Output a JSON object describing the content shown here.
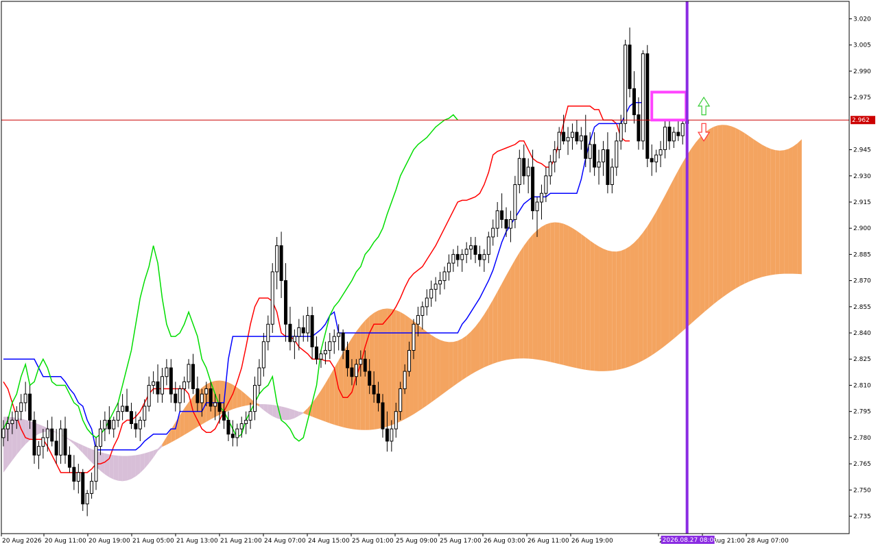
{
  "chart_data": {
    "type": "candlestick",
    "y_range": [
      2.725,
      3.03
    ],
    "y_ticks": [
      "3.020",
      "3.005",
      "2.990",
      "2.975",
      "2.962",
      "2.945",
      "2.930",
      "2.915",
      "2.900",
      "2.885",
      "2.870",
      "2.855",
      "2.840",
      "2.825",
      "2.810",
      "2.795",
      "2.780",
      "2.765",
      "2.750",
      "2.735"
    ],
    "x_ticks": [
      "20 Aug 2026",
      "20 Aug 11:00",
      "20 Aug 19:00",
      "21 Aug 05:00",
      "21 Aug 13:00",
      "21 Aug 21:00",
      "24 Aug 07:00",
      "24 Aug 15:00",
      "25 Aug 01:00",
      "25 Aug 09:00",
      "25 Aug 17:00",
      "26 Aug 03:00",
      "26 Aug 11:00",
      "26 Aug 19:00",
      "27 Aug 13:00",
      "27 Aug 21:00",
      "28 Aug 07:00"
    ],
    "current_price": {
      "value": 2.962,
      "label": "2.962"
    },
    "cursor": {
      "bar_index": 155,
      "label": "2026.08.27 08:00"
    },
    "candles": [
      [
        2.78,
        2.79,
        2.775,
        2.785
      ],
      [
        2.785,
        2.792,
        2.778,
        2.788
      ],
      [
        2.788,
        2.795,
        2.782,
        2.79
      ],
      [
        2.79,
        2.798,
        2.785,
        2.795
      ],
      [
        2.795,
        2.805,
        2.79,
        2.8
      ],
      [
        2.8,
        2.812,
        2.795,
        2.805
      ],
      [
        2.805,
        2.81,
        2.785,
        2.79
      ],
      [
        2.79,
        2.795,
        2.765,
        2.77
      ],
      [
        2.77,
        2.778,
        2.762,
        2.775
      ],
      [
        2.775,
        2.785,
        2.768,
        2.78
      ],
      [
        2.78,
        2.79,
        2.772,
        2.785
      ],
      [
        2.785,
        2.792,
        2.775,
        2.778
      ],
      [
        2.778,
        2.785,
        2.765,
        2.77
      ],
      [
        2.77,
        2.79,
        2.765,
        2.785
      ],
      [
        2.785,
        2.792,
        2.765,
        2.77
      ],
      [
        2.77,
        2.775,
        2.76,
        2.763
      ],
      [
        2.763,
        2.77,
        2.75,
        2.755
      ],
      [
        2.755,
        2.765,
        2.748,
        2.76
      ],
      [
        2.76,
        2.762,
        2.738,
        2.742
      ],
      [
        2.742,
        2.75,
        2.735,
        2.748
      ],
      [
        2.748,
        2.76,
        2.745,
        2.755
      ],
      [
        2.755,
        2.78,
        2.75,
        2.775
      ],
      [
        2.775,
        2.79,
        2.77,
        2.785
      ],
      [
        2.785,
        2.795,
        2.778,
        2.79
      ],
      [
        2.79,
        2.798,
        2.782,
        2.785
      ],
      [
        2.785,
        2.792,
        2.78,
        2.79
      ],
      [
        2.79,
        2.8,
        2.786,
        2.795
      ],
      [
        2.795,
        2.805,
        2.79,
        2.798
      ],
      [
        2.798,
        2.808,
        2.795,
        2.795
      ],
      [
        2.795,
        2.8,
        2.785,
        2.788
      ],
      [
        2.788,
        2.795,
        2.78,
        2.785
      ],
      [
        2.785,
        2.792,
        2.778,
        2.79
      ],
      [
        2.79,
        2.802,
        2.786,
        2.798
      ],
      [
        2.798,
        2.815,
        2.795,
        2.81
      ],
      [
        2.81,
        2.818,
        2.805,
        2.812
      ],
      [
        2.812,
        2.822,
        2.8,
        2.805
      ],
      [
        2.805,
        2.82,
        2.8,
        2.815
      ],
      [
        2.815,
        2.825,
        2.81,
        2.82
      ],
      [
        2.82,
        2.825,
        2.8,
        2.805
      ],
      [
        2.805,
        2.812,
        2.795,
        2.8
      ],
      [
        2.8,
        2.81,
        2.795,
        2.808
      ],
      [
        2.808,
        2.815,
        2.8,
        2.812
      ],
      [
        2.812,
        2.825,
        2.808,
        2.822
      ],
      [
        2.822,
        2.828,
        2.805,
        2.808
      ],
      [
        2.808,
        2.815,
        2.795,
        2.8
      ],
      [
        2.8,
        2.808,
        2.792,
        2.805
      ],
      [
        2.805,
        2.812,
        2.798,
        2.808
      ],
      [
        2.808,
        2.812,
        2.795,
        2.798
      ],
      [
        2.798,
        2.805,
        2.79,
        2.8
      ],
      [
        2.8,
        2.805,
        2.788,
        2.795
      ],
      [
        2.795,
        2.8,
        2.785,
        2.79
      ],
      [
        2.79,
        2.795,
        2.778,
        2.782
      ],
      [
        2.782,
        2.79,
        2.775,
        2.78
      ],
      [
        2.78,
        2.788,
        2.775,
        2.785
      ],
      [
        2.785,
        2.792,
        2.78,
        2.788
      ],
      [
        2.788,
        2.795,
        2.782,
        2.79
      ],
      [
        2.79,
        2.8,
        2.785,
        2.795
      ],
      [
        2.795,
        2.815,
        2.79,
        2.81
      ],
      [
        2.81,
        2.825,
        2.805,
        2.82
      ],
      [
        2.82,
        2.84,
        2.815,
        2.835
      ],
      [
        2.835,
        2.85,
        2.83,
        2.845
      ],
      [
        2.845,
        2.88,
        2.84,
        2.875
      ],
      [
        2.875,
        2.895,
        2.865,
        2.89
      ],
      [
        2.89,
        2.898,
        2.86,
        2.87
      ],
      [
        2.87,
        2.88,
        2.835,
        2.845
      ],
      [
        2.845,
        2.855,
        2.83,
        2.835
      ],
      [
        2.835,
        2.842,
        2.825,
        2.838
      ],
      [
        2.838,
        2.848,
        2.83,
        2.843
      ],
      [
        2.843,
        2.85,
        2.835,
        2.84
      ],
      [
        2.84,
        2.855,
        2.835,
        2.85
      ],
      [
        2.85,
        2.855,
        2.825,
        2.832
      ],
      [
        2.832,
        2.838,
        2.822,
        2.825
      ],
      [
        2.825,
        2.83,
        2.82,
        2.828
      ],
      [
        2.828,
        2.835,
        2.822,
        2.83
      ],
      [
        2.83,
        2.84,
        2.825,
        2.835
      ],
      [
        2.835,
        2.842,
        2.828,
        2.838
      ],
      [
        2.838,
        2.845,
        2.83,
        2.84
      ],
      [
        2.84,
        2.842,
        2.825,
        2.83
      ],
      [
        2.83,
        2.835,
        2.815,
        2.82
      ],
      [
        2.82,
        2.825,
        2.81,
        2.815
      ],
      [
        2.815,
        2.825,
        2.81,
        2.822
      ],
      [
        2.822,
        2.83,
        2.815,
        2.825
      ],
      [
        2.825,
        2.83,
        2.815,
        2.818
      ],
      [
        2.818,
        2.825,
        2.805,
        2.81
      ],
      [
        2.81,
        2.818,
        2.8,
        2.805
      ],
      [
        2.805,
        2.812,
        2.795,
        2.8
      ],
      [
        2.8,
        2.805,
        2.78,
        2.785
      ],
      [
        2.785,
        2.795,
        2.772,
        2.778
      ],
      [
        2.778,
        2.79,
        2.772,
        2.785
      ],
      [
        2.785,
        2.8,
        2.78,
        2.795
      ],
      [
        2.795,
        2.812,
        2.79,
        2.808
      ],
      [
        2.808,
        2.822,
        2.805,
        2.818
      ],
      [
        2.818,
        2.835,
        2.815,
        2.83
      ],
      [
        2.83,
        2.848,
        2.825,
        2.845
      ],
      [
        2.845,
        2.855,
        2.838,
        2.85
      ],
      [
        2.85,
        2.858,
        2.842,
        2.855
      ],
      [
        2.855,
        2.865,
        2.85,
        2.86
      ],
      [
        2.86,
        2.87,
        2.855,
        2.865
      ],
      [
        2.865,
        2.872,
        2.858,
        2.868
      ],
      [
        2.868,
        2.875,
        2.862,
        2.87
      ],
      [
        2.87,
        2.878,
        2.865,
        2.875
      ],
      [
        2.875,
        2.885,
        2.87,
        2.88
      ],
      [
        2.88,
        2.888,
        2.875,
        2.885
      ],
      [
        2.885,
        2.89,
        2.878,
        2.882
      ],
      [
        2.882,
        2.888,
        2.875,
        2.885
      ],
      [
        2.885,
        2.892,
        2.88,
        2.888
      ],
      [
        2.888,
        2.895,
        2.882,
        2.89
      ],
      [
        2.89,
        2.895,
        2.88,
        2.885
      ],
      [
        2.885,
        2.89,
        2.878,
        2.882
      ],
      [
        2.882,
        2.888,
        2.875,
        2.885
      ],
      [
        2.885,
        2.898,
        2.88,
        2.895
      ],
      [
        2.895,
        2.905,
        2.89,
        2.9
      ],
      [
        2.9,
        2.915,
        2.895,
        2.91
      ],
      [
        2.91,
        2.92,
        2.9,
        2.905
      ],
      [
        2.905,
        2.912,
        2.895,
        2.9
      ],
      [
        2.9,
        2.91,
        2.892,
        2.905
      ],
      [
        2.905,
        2.93,
        2.9,
        2.925
      ],
      [
        2.925,
        2.945,
        2.92,
        2.94
      ],
      [
        2.94,
        2.948,
        2.925,
        2.93
      ],
      [
        2.93,
        2.94,
        2.92,
        2.935
      ],
      [
        2.935,
        2.945,
        2.905,
        2.91
      ],
      [
        2.91,
        2.918,
        2.895,
        2.915
      ],
      [
        2.915,
        2.925,
        2.905,
        2.92
      ],
      [
        2.92,
        2.935,
        2.915,
        2.93
      ],
      [
        2.93,
        2.942,
        2.925,
        2.938
      ],
      [
        2.938,
        2.95,
        2.932,
        2.945
      ],
      [
        2.945,
        2.958,
        2.94,
        2.955
      ],
      [
        2.955,
        2.965,
        2.948,
        2.95
      ],
      [
        2.95,
        2.958,
        2.942,
        2.952
      ],
      [
        2.952,
        2.96,
        2.945,
        2.955
      ],
      [
        2.955,
        2.962,
        2.948,
        2.95
      ],
      [
        2.95,
        2.958,
        2.945,
        2.953
      ],
      [
        2.953,
        2.965,
        2.935,
        2.94
      ],
      [
        2.94,
        2.955,
        2.932,
        2.948
      ],
      [
        2.948,
        2.955,
        2.93,
        2.935
      ],
      [
        2.935,
        2.945,
        2.925,
        2.938
      ],
      [
        2.938,
        2.95,
        2.93,
        2.945
      ],
      [
        2.945,
        2.955,
        2.92,
        2.925
      ],
      [
        2.925,
        2.94,
        2.92,
        2.935
      ],
      [
        2.935,
        2.955,
        2.93,
        2.95
      ],
      [
        2.95,
        2.965,
        2.945,
        2.96
      ],
      [
        2.96,
        3.008,
        2.955,
        3.005
      ],
      [
        3.005,
        3.015,
        2.975,
        2.98
      ],
      [
        2.98,
        2.99,
        2.96,
        2.965
      ],
      [
        2.965,
        2.975,
        2.945,
        2.95
      ],
      [
        2.95,
        3.002,
        2.945,
        3.0
      ],
      [
        3.0,
        3.005,
        2.935,
        2.94
      ],
      [
        2.94,
        2.948,
        2.93,
        2.938
      ],
      [
        2.938,
        2.945,
        2.932,
        2.942
      ],
      [
        2.942,
        2.95,
        2.935,
        2.945
      ],
      [
        2.945,
        2.962,
        2.94,
        2.958
      ],
      [
        2.958,
        2.962,
        2.945,
        2.95
      ],
      [
        2.95,
        2.958,
        2.946,
        2.955
      ],
      [
        2.955,
        2.962,
        2.95,
        2.953
      ],
      [
        2.953,
        2.962,
        2.948,
        2.96
      ],
      [
        2.96,
        2.966,
        2.952,
        2.962
      ]
    ],
    "series": [
      {
        "color": "#ff0000",
        "values": [
          2.812,
          2.808,
          2.8,
          2.792,
          2.785,
          2.78,
          2.779,
          2.779,
          2.779,
          2.779,
          2.775,
          2.77,
          2.765,
          2.76,
          2.76,
          2.76,
          2.76,
          2.76,
          2.76,
          2.76,
          2.762,
          2.765,
          2.765,
          2.766,
          2.768,
          2.775,
          2.78,
          2.788,
          2.79,
          2.79,
          2.792,
          2.795,
          2.8,
          2.805,
          2.808,
          2.808,
          2.808,
          2.808,
          2.808,
          2.808,
          2.808,
          2.808,
          2.805,
          2.795,
          2.79,
          2.785,
          2.783,
          2.783,
          2.785,
          2.79,
          2.795,
          2.8,
          2.805,
          2.812,
          2.82,
          2.832,
          2.845,
          2.855,
          2.86,
          2.86,
          2.86,
          2.858,
          2.852,
          2.84,
          2.838,
          2.838,
          2.836,
          2.832,
          2.83,
          2.828,
          2.825,
          2.825,
          2.825,
          2.824,
          2.824,
          2.82,
          2.808,
          2.803,
          2.803,
          2.806,
          2.815,
          2.822,
          2.832,
          2.84,
          2.845,
          2.845,
          2.845,
          2.848,
          2.851,
          2.855,
          2.86,
          2.866,
          2.871,
          2.874,
          2.876,
          2.878,
          2.882,
          2.886,
          2.89,
          2.895,
          2.9,
          2.905,
          2.91,
          2.915,
          2.916,
          2.916,
          2.917,
          2.918,
          2.92,
          2.925,
          2.932,
          2.942,
          2.944,
          2.945,
          2.946,
          2.947,
          2.948,
          2.95,
          2.95,
          2.945,
          2.94,
          2.938,
          2.937,
          2.935,
          2.935,
          2.94,
          2.95,
          2.96,
          2.97,
          2.97,
          2.97,
          2.97,
          2.97,
          2.97,
          2.968,
          2.968,
          2.962,
          2.962,
          2.962,
          2.96,
          2.952,
          2.95,
          2.95
        ]
      },
      {
        "color": "#0000ff",
        "values": [
          2.825,
          2.825,
          2.825,
          2.825,
          2.825,
          2.825,
          2.825,
          2.825,
          2.82,
          2.815,
          2.815,
          2.815,
          2.815,
          2.815,
          2.812,
          2.808,
          2.805,
          2.8,
          2.798,
          2.79,
          2.785,
          2.773,
          2.773,
          2.773,
          2.773,
          2.773,
          2.773,
          2.773,
          2.773,
          2.773,
          2.773,
          2.775,
          2.778,
          2.78,
          2.782,
          2.782,
          2.782,
          2.782,
          2.785,
          2.785,
          2.795,
          2.795,
          2.795,
          2.795,
          2.795,
          2.795,
          2.8,
          2.8,
          2.8,
          2.8,
          2.8,
          2.825,
          2.838,
          2.838,
          2.838,
          2.838,
          2.838,
          2.838,
          2.838,
          2.838,
          2.838,
          2.838,
          2.838,
          2.838,
          2.838,
          2.838,
          2.838,
          2.838,
          2.838,
          2.838,
          2.838,
          2.84,
          2.842,
          2.845,
          2.85,
          2.852,
          2.84,
          2.84,
          2.84,
          2.84,
          2.84,
          2.84,
          2.84,
          2.84,
          2.84,
          2.84,
          2.84,
          2.84,
          2.84,
          2.84,
          2.84,
          2.84,
          2.84,
          2.84,
          2.84,
          2.84,
          2.84,
          2.84,
          2.84,
          2.84,
          2.84,
          2.84,
          2.84,
          2.84,
          2.845,
          2.848,
          2.852,
          2.856,
          2.86,
          2.865,
          2.87,
          2.876,
          2.884,
          2.892,
          2.898,
          2.902,
          2.906,
          2.91,
          2.914,
          2.916,
          2.918,
          2.918,
          2.918,
          2.918,
          2.92,
          2.92,
          2.92,
          2.92,
          2.92,
          2.92,
          2.92,
          2.928,
          2.94,
          2.95,
          2.958,
          2.96,
          2.96,
          2.96,
          2.96,
          2.96,
          2.96,
          2.965,
          2.97,
          2.972,
          2.972,
          2.972
        ]
      },
      {
        "color": "#00dd00",
        "values": [
          2.785,
          2.79,
          2.8,
          2.805,
          2.815,
          2.822,
          2.81,
          2.812,
          2.82,
          2.825,
          2.82,
          2.812,
          2.81,
          2.81,
          2.81,
          2.805,
          2.8,
          2.798,
          2.79,
          2.785,
          2.782,
          2.78,
          2.782,
          2.785,
          2.79,
          2.795,
          2.8,
          2.81,
          2.82,
          2.83,
          2.845,
          2.86,
          2.87,
          2.878,
          2.89,
          2.88,
          2.86,
          2.845,
          2.838,
          2.838,
          2.84,
          2.845,
          2.852,
          2.845,
          2.838,
          2.825,
          2.82,
          2.812,
          2.805,
          2.798,
          2.795,
          2.79,
          2.785,
          2.78,
          2.782,
          2.79,
          2.795,
          2.8,
          2.805,
          2.808,
          2.81,
          2.815,
          2.8,
          2.79,
          2.788,
          2.785,
          2.78,
          2.778,
          2.78,
          2.79,
          2.8,
          2.81,
          2.83,
          2.84,
          2.85,
          2.855,
          2.858,
          2.862,
          2.866,
          2.87,
          2.875,
          2.878,
          2.885,
          2.888,
          2.892,
          2.895,
          2.9,
          2.908,
          2.915,
          2.922,
          2.93,
          2.935,
          2.94,
          2.945,
          2.948,
          2.95,
          2.952,
          2.955,
          2.958,
          2.96,
          2.962,
          2.963,
          2.965,
          2.962
        ]
      },
      {
        "fill": "#f4a460",
        "name": "cloud_bull"
      },
      {
        "fill": "#d8bfd8",
        "name": "cloud_bear"
      }
    ],
    "arrows": {
      "up_color": "#33cc33",
      "down_color": "#ff3333"
    },
    "highlight_box_color": "#ff44ff"
  }
}
